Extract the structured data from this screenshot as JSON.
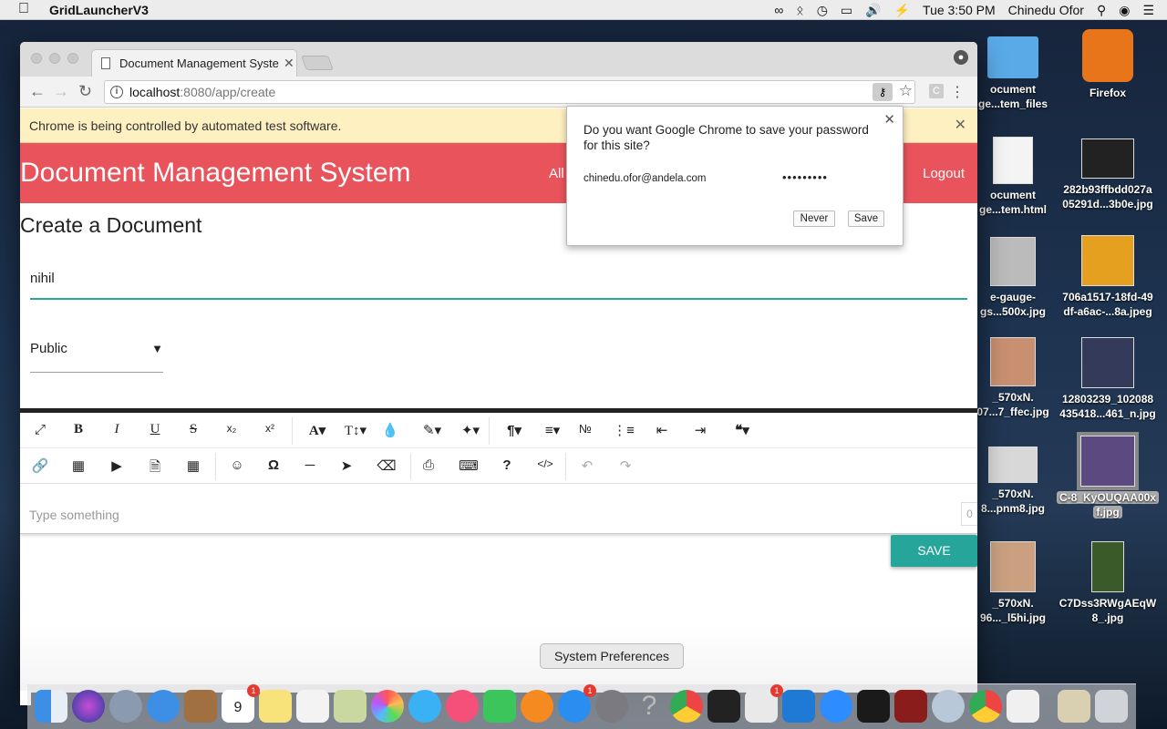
{
  "menubar": {
    "app_name": "GridLauncherV3",
    "clock": "Tue 3:50 PM",
    "user": "Chinedu Ofor",
    "icons": [
      "apple-icon",
      "infinity-icon",
      "bluetooth-icon",
      "wifi-icon",
      "airplay-icon",
      "volume-icon",
      "battery-icon",
      "search-icon",
      "siri-icon",
      "list-icon"
    ]
  },
  "browser": {
    "tab_title": "Document Management Syste",
    "url_host": "localhost",
    "url_rest": ":8080/app/create",
    "extension_letter": "C",
    "infobar_text": "Chrome is being controlled by automated test software."
  },
  "page": {
    "brand": "Document Management System",
    "nav_all": "All",
    "logout": "Logout",
    "heading": "Create a Document",
    "title_value": "nihil",
    "access_value": "Public",
    "editor_placeholder": "Type something",
    "char_count": "0",
    "save_label": "SAVE"
  },
  "password_bubble": {
    "question": "Do you want Google Chrome to save your password for this site?",
    "username": "chinedu.ofor@andela.com",
    "password_mask": "•••••••••",
    "never_label": "Never",
    "save_label": "Save"
  },
  "desktop_icons": [
    {
      "line1": "ocument",
      "line2": "ge...tem_files"
    },
    {
      "line1": "Firefox",
      "line2": ""
    },
    {
      "line1": "ocument",
      "line2": "ge...tem.html"
    },
    {
      "line1": "282b93ffbdd027a",
      "line2": "05291d...3b0e.jpg"
    },
    {
      "line1": "e-gauge-",
      "line2": "gs...500x.jpg"
    },
    {
      "line1": "706a1517-18fd-49",
      "line2": "df-a6ac-...8a.jpeg"
    },
    {
      "line1": "_570xN.",
      "line2": "07...7_ffec.jpg"
    },
    {
      "line1": "12803239_102088",
      "line2": "435418...461_n.jpg"
    },
    {
      "line1": "_570xN.",
      "line2": "8...pnm8.jpg"
    },
    {
      "line1": "C-8_KyOUQAA00x",
      "line2": "f.jpg"
    },
    {
      "line1": "_570xN.",
      "line2": "96..._l5hi.jpg"
    },
    {
      "line1": "C7Dss3RWgAEqW",
      "line2": "8_.jpg"
    }
  ],
  "dock": {
    "tooltip": "System Preferences",
    "calendar_month": "MAY",
    "calendar_day": "9",
    "badges": [
      "1",
      "1",
      "1"
    ]
  },
  "colors": {
    "brand_red": "#e9535b",
    "teal": "#26a69a",
    "infobar": "#fef0c0"
  }
}
